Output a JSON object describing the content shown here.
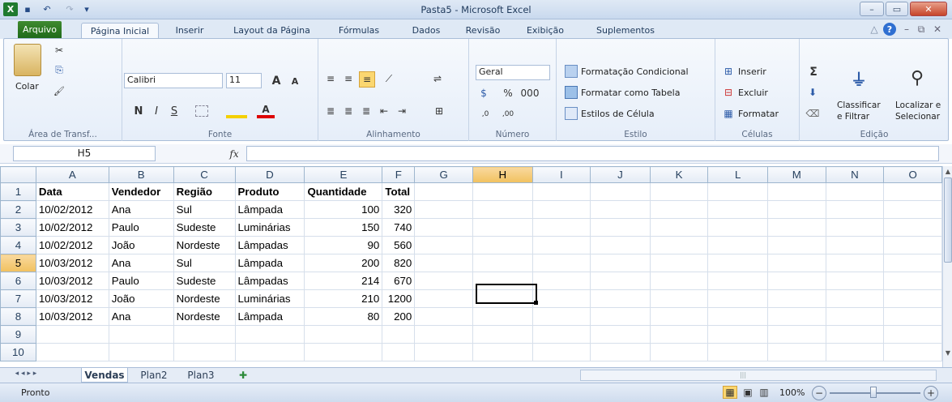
{
  "window": {
    "title": "Pasta5 - Microsoft Excel",
    "min": "–",
    "max": "▭",
    "close": "✕"
  },
  "qat": {
    "logo": "X",
    "save": "▪",
    "undo": "↶",
    "redo": "↷",
    "more": "▾"
  },
  "tabs": [
    "Arquivo",
    "Página Inicial",
    "Inserir",
    "Layout da Página",
    "Fórmulas",
    "Dados",
    "Revisão",
    "Exibição",
    "Suplementos"
  ],
  "tab_icons": {
    "help": "?",
    "minimize": "–",
    "restore": "⧉",
    "close": "✕",
    "caret": "△"
  },
  "ribbon": {
    "clipboard": {
      "paste": "Colar",
      "label": "Área de Transf...",
      "cut": "✂",
      "copy": "⎘",
      "brush": "🖌"
    },
    "font": {
      "name": "Calibri",
      "size": "11",
      "grow": "A",
      "shrink": "A",
      "bold": "N",
      "italic": "I",
      "underline": "S",
      "label": "Fonte"
    },
    "alignment": {
      "label": "Alinhamento"
    },
    "number": {
      "format": "Geral",
      "percent": "%",
      "thousands": "000",
      "inc": ",0",
      "dec": ",00",
      "label": "Número"
    },
    "styles": {
      "cond": "Formatação Condicional",
      "table": "Formatar como Tabela",
      "cell": "Estilos de Célula",
      "label": "Estilo"
    },
    "cells": {
      "insert": "Inserir",
      "delete": "Excluir",
      "format": "Formatar",
      "label": "Células"
    },
    "editing": {
      "sum": "Σ",
      "sort1": "Classificar",
      "sort2": "e Filtrar",
      "find1": "Localizar e",
      "find2": "Selecionar",
      "label": "Edição"
    }
  },
  "formula_bar": {
    "name_box": "H5",
    "fx": "fx",
    "value": ""
  },
  "columns": [
    "A",
    "B",
    "C",
    "D",
    "E",
    "F",
    "G",
    "H",
    "I",
    "J",
    "K",
    "L",
    "M",
    "N",
    "O"
  ],
  "selected_col": "H",
  "selected_row": "5",
  "rows": [
    {
      "n": "1",
      "cells": [
        "Data",
        "Vendedor",
        "Região",
        "Produto",
        "Quantidade",
        "Total"
      ]
    },
    {
      "n": "2",
      "cells": [
        "10/02/2012",
        "Ana",
        "Sul",
        "Lâmpada",
        "100",
        "320"
      ]
    },
    {
      "n": "3",
      "cells": [
        "10/02/2012",
        "Paulo",
        "Sudeste",
        "Luminárias",
        "150",
        "740"
      ]
    },
    {
      "n": "4",
      "cells": [
        "10/02/2012",
        "João",
        "Nordeste",
        "Lâmpadas",
        "90",
        "560"
      ]
    },
    {
      "n": "5",
      "cells": [
        "10/03/2012",
        "Ana",
        "Sul",
        "Lâmpada",
        "200",
        "820"
      ]
    },
    {
      "n": "6",
      "cells": [
        "10/03/2012",
        "Paulo",
        "Sudeste",
        "Lâmpadas",
        "214",
        "670"
      ]
    },
    {
      "n": "7",
      "cells": [
        "10/03/2012",
        "João",
        "Nordeste",
        "Luminárias",
        "210",
        "1200"
      ]
    },
    {
      "n": "8",
      "cells": [
        "10/03/2012",
        "Ana",
        "Nordeste",
        "Lâmpada",
        "80",
        "200"
      ]
    },
    {
      "n": "9",
      "cells": [
        "",
        "",
        "",
        "",
        "",
        ""
      ]
    },
    {
      "n": "10",
      "cells": [
        "",
        "",
        "",
        "",
        "",
        ""
      ]
    }
  ],
  "sheets": {
    "nav": "◂ ◂ ▸ ▸",
    "tab1": "Vendas",
    "tab2": "Plan2",
    "tab3": "Plan3"
  },
  "status": {
    "ready": "Pronto",
    "zoom": "100%",
    "minus": "−",
    "plus": "+"
  }
}
